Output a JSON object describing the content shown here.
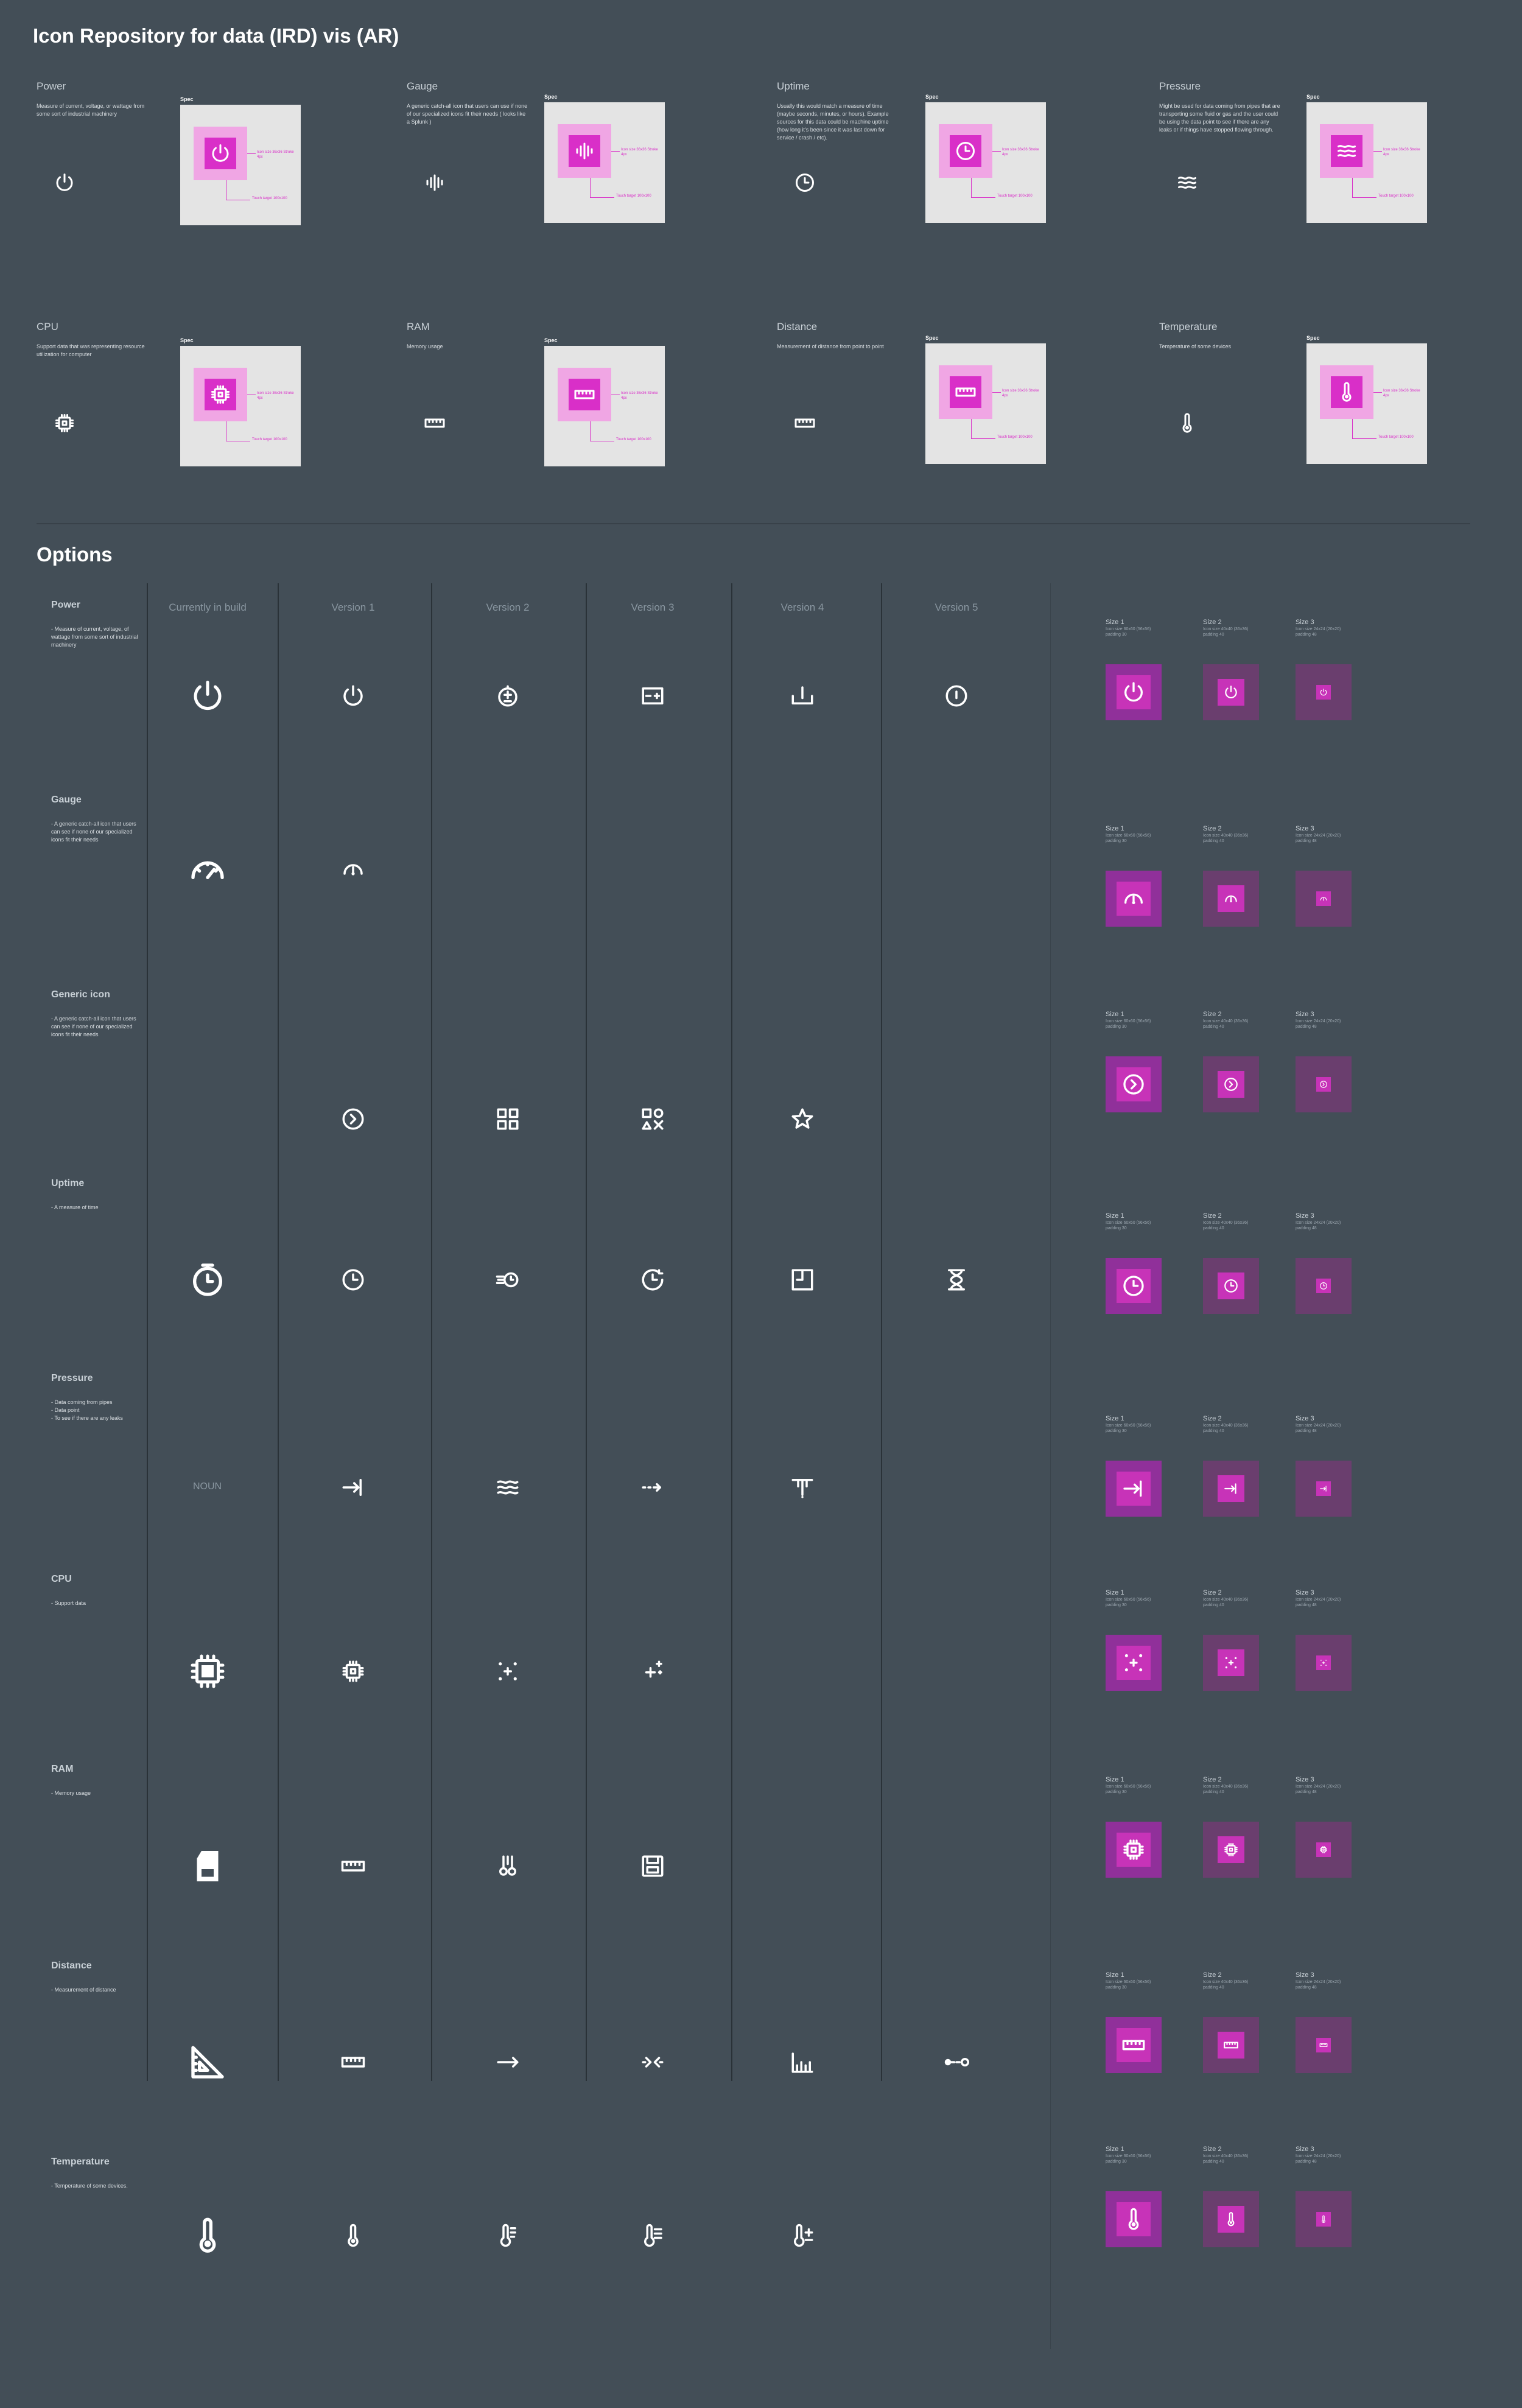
{
  "page": {
    "title": "Icon Repository for data (IRD) vis (AR)",
    "options_title": "Options",
    "spec_label": "Spec",
    "spec_icon_size": "Icon size 36x36\nStroke 4px",
    "spec_touch_target": "Touch target\n100x100"
  },
  "repo_cards": [
    {
      "title": "Power",
      "desc": "Measure of current, voltage, or wattage from some sort of industrial machinery",
      "icon": "power-icon"
    },
    {
      "title": "Gauge",
      "desc": "A generic catch-all icon that users can use if none of our specialized icons fit their needs ( looks like a Splunk )",
      "icon": "gauge-wave-icon"
    },
    {
      "title": "Uptime",
      "desc": "Usually this would match a measure of time (maybe seconds, minutes, or hours). Example sources for this data could be machine uptime (how long it's been since it was last down for service / crash / etc).",
      "icon": "clock-icon"
    },
    {
      "title": "Pressure",
      "desc": "Might be used for data coming from pipes that are transporting some fluid or gas and the user could be using the data point to see if there are any leaks or if things have stopped flowing through.",
      "icon": "waves-icon"
    },
    {
      "title": "CPU",
      "desc": "Support data that was representing resource utilization for computer",
      "icon": "cpu-icon"
    },
    {
      "title": "RAM",
      "desc": "Memory usage",
      "icon": "ram-icon"
    },
    {
      "title": "Distance",
      "desc": "Measurement of distance from point to point",
      "icon": "ruler-icon"
    },
    {
      "title": "Temperature",
      "desc": "Temperature of some devices",
      "icon": "thermometer-icon"
    }
  ],
  "columns": [
    "Currently in build",
    "Version 1",
    "Version 2",
    "Version 3",
    "Version 4",
    "Version 5"
  ],
  "rows": [
    {
      "title": "Power",
      "desc": "- Measure of current, voltage, of wattage from some sort of industrial machinery"
    },
    {
      "title": "Gauge",
      "desc": "- A generic catch-all icon that users can see if none of our specialized icons fit their needs"
    },
    {
      "title": "Generic icon",
      "desc": "- A generic catch-all icon that users can see if none of our specialized icons fit their needs"
    },
    {
      "title": "Uptime",
      "desc": "- A measure of time"
    },
    {
      "title": "Pressure",
      "desc": "- Data coming from pipes\n- Data point\n- To see if there are any leaks"
    },
    {
      "title": "CPU",
      "desc": "- Support data"
    },
    {
      "title": "RAM",
      "desc": "- Memory usage"
    },
    {
      "title": "Distance",
      "desc": "- Measurement of distance"
    },
    {
      "title": "Temperature",
      "desc": "- Temperature of some devices."
    }
  ],
  "noun_placeholder": "NOUN",
  "sizes": [
    {
      "label": "Size 1",
      "sub": "Icon size 60x60 (56x56)\npadding 30"
    },
    {
      "label": "Size 2",
      "sub": "Icon size 40x40 (36x36)\npadding 40"
    },
    {
      "label": "Size 3",
      "sub": "Icon size 24x24 (20x20)\npadding 48"
    }
  ],
  "colors": {
    "background": "#434e57",
    "accent": "#d92fc8",
    "spec_bg": "#e4e4e4"
  }
}
